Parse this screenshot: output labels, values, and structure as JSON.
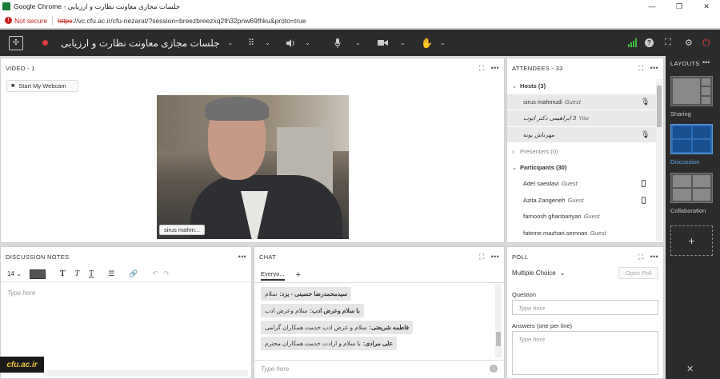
{
  "window": {
    "title": "Google Chrome - جلسات مجازی معاونت نظارت و ارزیابی",
    "min": "—",
    "max": "❐",
    "close": "✕"
  },
  "address": {
    "security": "Not secure",
    "scheme": "https",
    "url_rest": "://vc.cfu.ac.ir/cfu-nezarat/?session=breezbreezxq2th32pnw69fhku&proto=true"
  },
  "app": {
    "meeting_title": "جلسات مجازی معاونت نظارت و ارزیابی",
    "accent": "#2f6fb8",
    "status_green": "#3fbf3f",
    "power_red": "#e23b3b"
  },
  "video": {
    "header": "VIDEO",
    "count": "1",
    "webcam_button": "Start My Webcam",
    "name_tag": "sirus mahm..."
  },
  "attendees": {
    "header": "ATTENDEES",
    "count": "33",
    "hosts_group": "Hosts (3)",
    "hosts": [
      {
        "name": "sirus mahmudi",
        "role": "Guest"
      },
      {
        "name": "3 ابراهیمی دکتر ایوب",
        "role": "You"
      },
      {
        "name": "مهرناش یونه",
        "role": ""
      }
    ],
    "presenters_group": "Presenters (0)",
    "participants_group": "Participants (30)",
    "participants": [
      {
        "name": "Adel saeidavi",
        "role": "Guest"
      },
      {
        "name": "Azita Zangeneh",
        "role": "Guest"
      },
      {
        "name": "farnoosh ghanbariyan",
        "role": "Guest"
      },
      {
        "name": "fateme.mazhari.semnan",
        "role": "Guest"
      }
    ]
  },
  "notes": {
    "header": "DISCUSSION NOTES",
    "font_size": "14",
    "placeholder": "Type here"
  },
  "chat": {
    "header": "CHAT",
    "tab": "Everyo...",
    "add": "+",
    "messages": [
      {
        "sender": "سیدمحمدرضا حسینی - یزد:",
        "text": "سلام"
      },
      {
        "sender": "با سلام وعرض ادب:",
        "text": "سلام وعرض ادب"
      },
      {
        "sender": "فاطمه شریعتی:",
        "text": "سلام و عرض ادب خدمت همکاران گرامی"
      },
      {
        "sender": "علی مرادی:",
        "text": "با سلام و ارادت خدمت همکاران محترم"
      }
    ],
    "placeholder": "Type here"
  },
  "poll": {
    "header": "POLL",
    "type": "Multiple Choice",
    "open_button": "Open Poll",
    "question_label": "Question",
    "question_placeholder": "Type here",
    "answers_label": "Answers (one per line)",
    "answers_placeholder": "Type here"
  },
  "layouts": {
    "header": "LAYOUTS",
    "items": [
      {
        "label": "Sharing"
      },
      {
        "label": "Discussion"
      },
      {
        "label": "Collaboration"
      }
    ],
    "add": "+"
  },
  "watermark": "cfu.ac.ir"
}
